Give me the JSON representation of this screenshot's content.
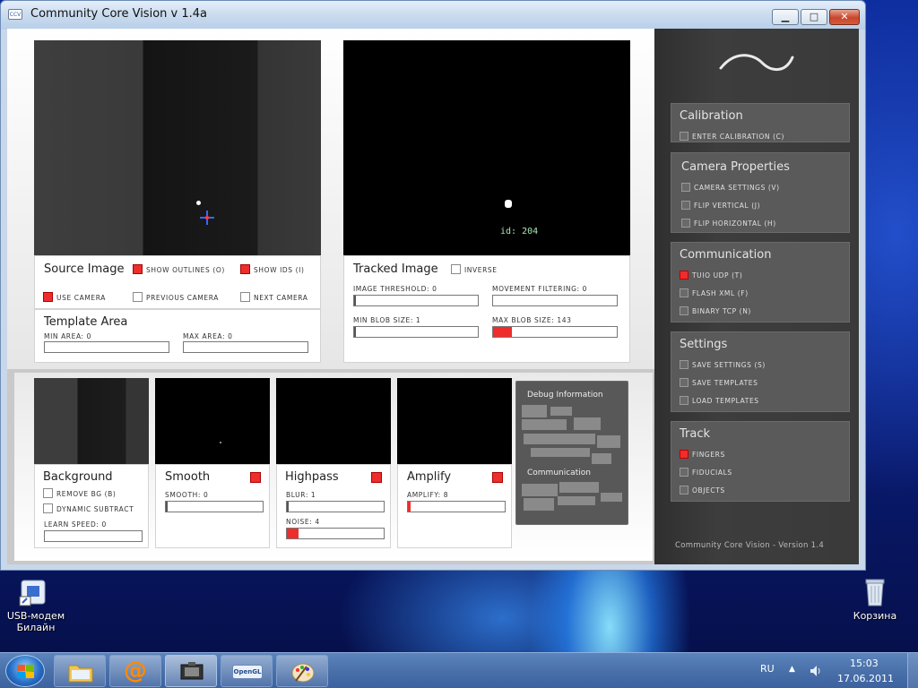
{
  "window": {
    "title": "Community Core Vision v 1.4a",
    "icon_text": "CCV",
    "min": "▁",
    "max": "□",
    "close": "✕"
  },
  "source": {
    "title": "Source Image",
    "show_outlines": "show outlines (o)",
    "show_ids": "show ids (i)",
    "use_camera": "use camera",
    "previous_camera": "previous camera",
    "next_camera": "next camera",
    "show_outlines_checked": true,
    "show_ids_checked": true,
    "use_camera_checked": true
  },
  "template": {
    "title": "Template Area",
    "min_area": "min area: 0",
    "max_area": "max area: 0"
  },
  "tracked": {
    "title": "Tracked Image",
    "inverse": "inverse",
    "blob_id": "id: 204",
    "image_threshold": "image threshold: 0",
    "movement_filtering": "movement filtering: 0",
    "min_blob_size": "min blob size: 1",
    "max_blob_size": "max blob size: 143",
    "max_blob_fraction": 0.15
  },
  "filters": {
    "background": {
      "title": "Background",
      "remove_bg": "remove bg (b)",
      "dynamic_subtract": "dynamic subtract",
      "learn_speed": "learn speed: 0"
    },
    "smooth": {
      "title": "Smooth",
      "label": "smooth: 0"
    },
    "highpass": {
      "title": "Highpass",
      "blur": "blur: 1",
      "noise": "noise: 4",
      "noise_fraction": 0.12
    },
    "amplify": {
      "title": "Amplify",
      "label": "amplify: 8"
    }
  },
  "debug": {
    "title": "Debug Information",
    "communication": "Communication"
  },
  "sidebar": {
    "calibration": {
      "title": "Calibration",
      "items": [
        "enter calibration (c)"
      ]
    },
    "camera": {
      "title": "Camera Properties",
      "items": [
        "camera settings (v)",
        "flip vertical (j)",
        "flip horizontal (h)"
      ]
    },
    "communication": {
      "title": "Communication",
      "items": [
        "tuio udp (t)",
        "flash xml (f)",
        "binary tcp (n)"
      ]
    },
    "settings": {
      "title": "Settings",
      "items": [
        "save settings (s)",
        "save templates",
        "load templates"
      ]
    },
    "track": {
      "title": "Track",
      "items": [
        "fingers",
        "fiducials",
        "objects"
      ]
    },
    "footer": "Community Core Vision - Version 1.4",
    "checked": {
      "tuio_udp": true,
      "fingers": true
    }
  },
  "desktop": {
    "usb_modem": "USB-модем Билайн",
    "recycle": "Корзина"
  },
  "taskbar": {
    "lang": "RU",
    "time": "15:03",
    "date": "17.06.2011"
  },
  "colors": {
    "accent_red": "#ee2d2d",
    "sidebar_bg": "#3a3a3a"
  }
}
